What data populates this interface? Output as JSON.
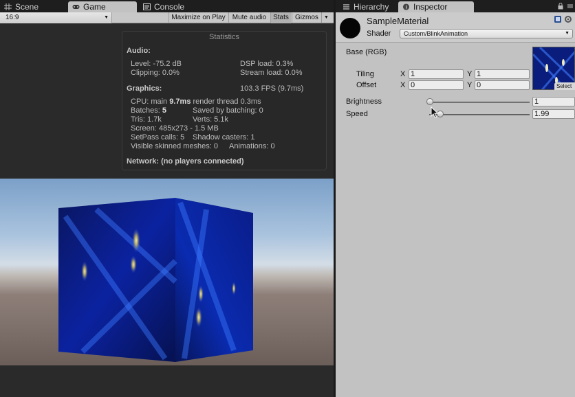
{
  "left_tabs": {
    "scene": "Scene",
    "game": "Game",
    "console": "Console"
  },
  "game_toolbar": {
    "aspect": "16:9",
    "maximize_on_play": "Maximize on Play",
    "mute_audio": "Mute audio",
    "stats": "Stats",
    "gizmos": "Gizmos"
  },
  "statistics": {
    "title": "Statistics",
    "audio_header": "Audio:",
    "level": "Level: -75.2 dB",
    "clipping": "Clipping: 0.0%",
    "dsp_load": "DSP load: 0.3%",
    "stream_load": "Stream load: 0.0%",
    "graphics_header": "Graphics:",
    "fps": "103.3 FPS (9.7ms)",
    "cpu_prefix": "CPU: main ",
    "cpu_main": "9.7ms",
    "cpu_suffix": "  render thread 0.3ms",
    "batches_prefix": "Batches: ",
    "batches": "5",
    "saved_by_batching": "Saved by batching: 0",
    "tris": "Tris: 1.7k",
    "verts": "Verts: 5.1k",
    "screen": "Screen: 485x273 - 1.5 MB",
    "setpass": "SetPass calls: 5",
    "shadow_casters": "Shadow casters: 1",
    "visible_skinned": "Visible skinned meshes: 0",
    "animations": "Animations: 0",
    "network": "Network: (no players connected)"
  },
  "right_tabs": {
    "hierarchy": "Hierarchy",
    "inspector": "Inspector"
  },
  "inspector": {
    "material_name": "SampleMaterial",
    "shader_label": "Shader",
    "shader_value": "Custom/BlinkAnimation",
    "base_label": "Base (RGB)",
    "tiling_label": "Tiling",
    "offset_label": "Offset",
    "x_label": "X",
    "y_label": "Y",
    "tiling_x": "1",
    "tiling_y": "1",
    "offset_x": "0",
    "offset_y": "0",
    "texture_select": "Select",
    "brightness_label": "Brightness",
    "brightness_value": "1",
    "speed_label": "Speed",
    "speed_value": "1.99"
  },
  "colors": {
    "panel_dark": "#2b2b2b",
    "inspector_bg": "#c2c2c2",
    "texture_blue": "#0d1f7a",
    "cube_blue": "#0a1a8a"
  }
}
